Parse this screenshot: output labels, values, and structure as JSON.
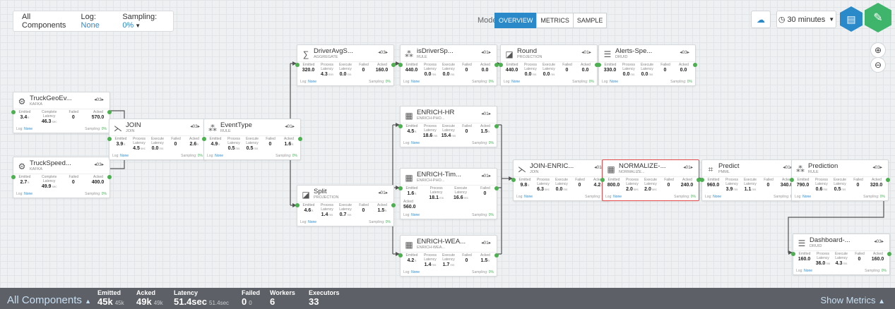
{
  "toolbar": {
    "components": "All Components",
    "log_label": "Log:",
    "log_value": "None",
    "sampling_label": "Sampling:",
    "sampling_value": "0%",
    "mode_label": "Mode:",
    "modes": [
      "OVERVIEW",
      "METRICS",
      "SAMPLE"
    ],
    "active_mode": "OVERVIEW",
    "time_range": "30 minutes",
    "icons": [
      "cloud-sync-icon",
      "clock-icon",
      "book-icon",
      "pencil-icon",
      "zoom-in-icon",
      "zoom-out-icon"
    ]
  },
  "colors": {
    "accent": "#2a89c9",
    "port": "#4caf50",
    "hex_book": "#2a89c9",
    "hex_edit": "#3fb46b",
    "selected": "#e24c4c",
    "footer_bg": "#5d6066"
  },
  "nodes": [
    {
      "id": "truckgeo",
      "title": "TruckGeoEv...",
      "subtitle": "KAFKA",
      "par": "03",
      "icon": "kafka-icon",
      "metrics": [
        {
          "label": "Emitted",
          "value": "3.4",
          "unit": "k"
        },
        {
          "label": "Complete Latency",
          "value": "46.3",
          "unit": "sec"
        },
        {
          "label": "Failed",
          "value": "0",
          "unit": ""
        },
        {
          "label": "Acked",
          "value": "570.0",
          "unit": ""
        }
      ],
      "log": "None",
      "sampling": "0%"
    },
    {
      "id": "truckspeed",
      "title": "TruckSpeed...",
      "subtitle": "KAFKA",
      "par": "03",
      "icon": "kafka-icon",
      "metrics": [
        {
          "label": "Emitted",
          "value": "2.7",
          "unit": "k"
        },
        {
          "label": "Complete Latency",
          "value": "49.9",
          "unit": "sec"
        },
        {
          "label": "Failed",
          "value": "0",
          "unit": ""
        },
        {
          "label": "Acked",
          "value": "400.0",
          "unit": ""
        }
      ],
      "log": "None",
      "sampling": "0%"
    },
    {
      "id": "join",
      "title": "JOIN",
      "subtitle": "JOIN",
      "par": "03",
      "icon": "join-icon",
      "metrics": [
        {
          "label": "Emitted",
          "value": "3.9",
          "unit": "k"
        },
        {
          "label": "Process Latency",
          "value": "4.5",
          "unit": "sec"
        },
        {
          "label": "Execute Latency",
          "value": "0.0",
          "unit": "ms"
        },
        {
          "label": "Failed",
          "value": "0",
          "unit": ""
        },
        {
          "label": "Acked",
          "value": "2.6",
          "unit": "k"
        }
      ],
      "log": "None",
      "sampling": "0%"
    },
    {
      "id": "eventtype",
      "title": "EventType",
      "subtitle": "RULE",
      "par": "01",
      "icon": "rule-icon",
      "metrics": [
        {
          "label": "Emitted",
          "value": "4.9",
          "unit": "k"
        },
        {
          "label": "Process Latency",
          "value": "0.5",
          "unit": "ms"
        },
        {
          "label": "Execute Latency",
          "value": "0.5",
          "unit": "ms"
        },
        {
          "label": "Failed",
          "value": "0",
          "unit": ""
        },
        {
          "label": "Acked",
          "value": "1.6",
          "unit": "k"
        }
      ],
      "log": "None",
      "sampling": "0%"
    },
    {
      "id": "driveravg",
      "title": "DriverAvgS...",
      "subtitle": "AGGREGATE",
      "par": "03",
      "icon": "sigma-icon",
      "metrics": [
        {
          "label": "Emitted",
          "value": "320.0",
          "unit": ""
        },
        {
          "label": "Process Latency",
          "value": "4.3",
          "unit": "min"
        },
        {
          "label": "Execute Latency",
          "value": "0.0",
          "unit": "ms"
        },
        {
          "label": "Failed",
          "value": "0",
          "unit": ""
        },
        {
          "label": "Acked",
          "value": "160.0",
          "unit": ""
        }
      ],
      "log": "None",
      "sampling": "0%"
    },
    {
      "id": "isdriversp",
      "title": "isDriverSp...",
      "subtitle": "RULE",
      "par": "01",
      "icon": "rule-icon",
      "metrics": [
        {
          "label": "Emitted",
          "value": "440.0",
          "unit": ""
        },
        {
          "label": "Process Latency",
          "value": "0.0",
          "unit": "ms"
        },
        {
          "label": "Execute Latency",
          "value": "0.0",
          "unit": "ms"
        },
        {
          "label": "Failed",
          "value": "0",
          "unit": ""
        },
        {
          "label": "Acked",
          "value": "0.0",
          "unit": ""
        }
      ],
      "log": "None",
      "sampling": "0%"
    },
    {
      "id": "round",
      "title": "Round",
      "subtitle": "PROJECTION",
      "par": "01",
      "icon": "projection-icon",
      "metrics": [
        {
          "label": "Emitted",
          "value": "440.0",
          "unit": ""
        },
        {
          "label": "Process Latency",
          "value": "0.0",
          "unit": "ms"
        },
        {
          "label": "Execute Latency",
          "value": "0.0",
          "unit": "ms"
        },
        {
          "label": "Failed",
          "value": "0",
          "unit": ""
        },
        {
          "label": "Acked",
          "value": "0.0",
          "unit": ""
        }
      ],
      "log": "None",
      "sampling": "0%"
    },
    {
      "id": "alertsspe",
      "title": "Alerts-Spe...",
      "subtitle": "DRUID",
      "par": "03",
      "icon": "druid-icon",
      "metrics": [
        {
          "label": "Emitted",
          "value": "330.0",
          "unit": ""
        },
        {
          "label": "Process Latency",
          "value": "0.0",
          "unit": "ms"
        },
        {
          "label": "Execute Latency",
          "value": "0.0",
          "unit": "ms"
        },
        {
          "label": "Failed",
          "value": "0",
          "unit": ""
        },
        {
          "label": "Acked",
          "value": "0.0",
          "unit": ""
        }
      ],
      "log": "None",
      "sampling": "0%"
    },
    {
      "id": "enrichhr",
      "title": "ENRICH-HR",
      "subtitle": "ENRICH-PHO...",
      "par": "01",
      "icon": "enrich-icon",
      "metrics": [
        {
          "label": "Emitted",
          "value": "4.5",
          "unit": "k"
        },
        {
          "label": "Process Latency",
          "value": "18.6",
          "unit": "ms"
        },
        {
          "label": "Execute Latency",
          "value": "15.4",
          "unit": "ms"
        },
        {
          "label": "Failed",
          "value": "0",
          "unit": ""
        },
        {
          "label": "Acked",
          "value": "1.5",
          "unit": "k"
        }
      ],
      "log": "None",
      "sampling": "0%"
    },
    {
      "id": "split",
      "title": "Split",
      "subtitle": "PROJECTION",
      "par": "01",
      "icon": "projection-icon",
      "metrics": [
        {
          "label": "Emitted",
          "value": "4.6",
          "unit": "k"
        },
        {
          "label": "Process Latency",
          "value": "1.4",
          "unit": "ms"
        },
        {
          "label": "Execute Latency",
          "value": "0.7",
          "unit": "ms"
        },
        {
          "label": "Failed",
          "value": "0",
          "unit": ""
        },
        {
          "label": "Acked",
          "value": "1.5",
          "unit": "k"
        }
      ],
      "log": "None",
      "sampling": "0%"
    },
    {
      "id": "enrichtim",
      "title": "ENRICH-Tim...",
      "subtitle": "ENRICH-PHO...",
      "par": "01",
      "icon": "enrich-icon",
      "metrics": [
        {
          "label": "Emitted",
          "value": "1.6",
          "unit": "k"
        },
        {
          "label": "Process Latency",
          "value": "18.1",
          "unit": "ms"
        },
        {
          "label": "Execute Latency",
          "value": "16.6",
          "unit": "ms"
        },
        {
          "label": "Failed",
          "value": "0",
          "unit": ""
        }
      ],
      "extra_label": "Acked",
      "extra_value": "560.0",
      "log": "None",
      "sampling": "0%"
    },
    {
      "id": "enrichwea",
      "title": "ENRICH-WEA...",
      "subtitle": "ENRICH-WEA...",
      "par": "01",
      "icon": "enrich-icon",
      "metrics": [
        {
          "label": "Emitted",
          "value": "4.2",
          "unit": "k"
        },
        {
          "label": "Process Latency",
          "value": "1.4",
          "unit": "ms"
        },
        {
          "label": "Execute Latency",
          "value": "1.7",
          "unit": "ms"
        },
        {
          "label": "Failed",
          "value": "0",
          "unit": ""
        },
        {
          "label": "Acked",
          "value": "1.5",
          "unit": "k"
        }
      ],
      "log": "None",
      "sampling": "0%"
    },
    {
      "id": "joinenric",
      "title": "JOIN-ENRIC...",
      "subtitle": "JOIN",
      "par": "01",
      "icon": "join-icon",
      "metrics": [
        {
          "label": "Emitted",
          "value": "9.8",
          "unit": "k"
        },
        {
          "label": "Process Latency",
          "value": "6.3",
          "unit": "sec"
        },
        {
          "label": "Execute Latency",
          "value": "0.0",
          "unit": "ms"
        },
        {
          "label": "Failed",
          "value": "0",
          "unit": ""
        },
        {
          "label": "Acked",
          "value": "4.2",
          "unit": "k"
        }
      ],
      "log": "None",
      "sampling": "0%"
    },
    {
      "id": "normalize",
      "title": "NORMALIZE-...",
      "subtitle": "NORMALIZE...",
      "par": "01",
      "icon": "enrich-icon",
      "metrics": [
        {
          "label": "Emitted",
          "value": "800.0",
          "unit": ""
        },
        {
          "label": "Process Latency",
          "value": "2.0",
          "unit": "sec"
        },
        {
          "label": "Execute Latency",
          "value": "2.0",
          "unit": "sec"
        },
        {
          "label": "Failed",
          "value": "0",
          "unit": ""
        },
        {
          "label": "Acked",
          "value": "240.0",
          "unit": ""
        }
      ],
      "log": "None",
      "sampling": "0%",
      "selected": true
    },
    {
      "id": "predict",
      "title": "Predict",
      "subtitle": "PMML",
      "par": "01",
      "icon": "pmml-icon",
      "metrics": [
        {
          "label": "Emitted",
          "value": "960.0",
          "unit": ""
        },
        {
          "label": "Process Latency",
          "value": "3.9",
          "unit": "ms"
        },
        {
          "label": "Execute Latency",
          "value": "1.1",
          "unit": "ms"
        },
        {
          "label": "Failed",
          "value": "0",
          "unit": ""
        },
        {
          "label": "Acked",
          "value": "340.0",
          "unit": ""
        }
      ],
      "log": "None",
      "sampling": "0%"
    },
    {
      "id": "prediction",
      "title": "Prediction",
      "subtitle": "RULE",
      "par": "03",
      "icon": "rule-icon",
      "metrics": [
        {
          "label": "Emitted",
          "value": "790.0",
          "unit": ""
        },
        {
          "label": "Process Latency",
          "value": "0.6",
          "unit": "ms"
        },
        {
          "label": "Execute Latency",
          "value": "0.5",
          "unit": "ms"
        },
        {
          "label": "Failed",
          "value": "0",
          "unit": ""
        },
        {
          "label": "Acked",
          "value": "320.0",
          "unit": ""
        }
      ],
      "log": "None",
      "sampling": "0%"
    },
    {
      "id": "dashboard",
      "title": "Dashboard-...",
      "subtitle": "DRUID",
      "par": "03",
      "icon": "druid-icon",
      "metrics": [
        {
          "label": "Emitted",
          "value": "160.0",
          "unit": ""
        },
        {
          "label": "Process Latency",
          "value": "36.0",
          "unit": "ms"
        },
        {
          "label": "Execute Latency",
          "value": "4.3",
          "unit": "ms"
        },
        {
          "label": "Failed",
          "value": "0",
          "unit": ""
        },
        {
          "label": "Acked",
          "value": "160.0",
          "unit": ""
        }
      ],
      "log": "None",
      "sampling": "0%"
    }
  ],
  "footer": {
    "title": "All Components",
    "stats": [
      {
        "label": "Emitted",
        "value": "45k",
        "sub": "45k"
      },
      {
        "label": "Acked",
        "value": "49k",
        "sub": "49k"
      },
      {
        "label": "Latency",
        "value": "51.4sec",
        "sub": "51.4sec"
      },
      {
        "label": "Failed",
        "value": "0",
        "sub": "0"
      },
      {
        "label": "Workers",
        "value": "6",
        "sub": ""
      },
      {
        "label": "Executors",
        "value": "33",
        "sub": ""
      }
    ],
    "show_metrics": "Show Metrics"
  }
}
